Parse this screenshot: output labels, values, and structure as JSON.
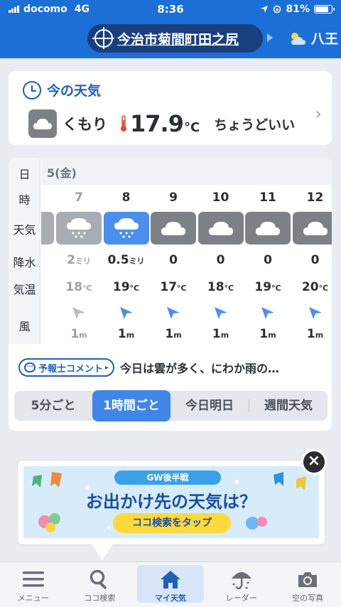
{
  "status_bar": {
    "carrier": "docomo",
    "network": "4G",
    "time": "8:36",
    "battery": "81%",
    "battery_level": 0.81
  },
  "header": {
    "location": "今治市菊間町田之尻",
    "next_location": "八王"
  },
  "current": {
    "title": "今の天気",
    "condition": "くもり",
    "temperature": "17.9",
    "unit": "°C",
    "feeling": "ちょうどいい"
  },
  "hourly": {
    "row_labels": {
      "day": "日",
      "hour": "時",
      "weather": "天気",
      "precip": "降水",
      "temp": "気温",
      "wind": "風"
    },
    "day": "5(金)",
    "hours": [
      {
        "hour": "7",
        "icon": "rain-icon",
        "precip": "2",
        "precip_unit": "ミリ",
        "temp": "18",
        "temp_unit": "°C",
        "wind": "1",
        "wind_unit": "m",
        "state": "past"
      },
      {
        "hour": "8",
        "icon": "rain-icon",
        "precip": "0.5",
        "precip_unit": "ミリ",
        "temp": "19",
        "temp_unit": "°C",
        "wind": "1",
        "wind_unit": "m",
        "state": "active"
      },
      {
        "hour": "9",
        "icon": "cloud-icon",
        "precip": "0",
        "precip_unit": "",
        "temp": "17",
        "temp_unit": "°C",
        "wind": "1",
        "wind_unit": "m",
        "state": ""
      },
      {
        "hour": "10",
        "icon": "cloud-icon",
        "precip": "0",
        "precip_unit": "",
        "temp": "18",
        "temp_unit": "°C",
        "wind": "1",
        "wind_unit": "m",
        "state": ""
      },
      {
        "hour": "11",
        "icon": "cloud-icon",
        "precip": "0",
        "precip_unit": "",
        "temp": "19",
        "temp_unit": "°C",
        "wind": "1",
        "wind_unit": "m",
        "state": ""
      },
      {
        "hour": "12",
        "icon": "cloud-icon",
        "precip": "0",
        "precip_unit": "",
        "temp": "20",
        "temp_unit": "°C",
        "wind": "1",
        "wind_unit": "m",
        "state": ""
      }
    ],
    "forecaster_tag": "予報士コメント",
    "forecaster_text": "今日は雲が多く、にわか雨の…",
    "segments": [
      "5分ごと",
      "1時間ごと",
      "今日明日",
      "週間天気"
    ],
    "active_segment": 1
  },
  "ad": {
    "badge": "GW後半戦",
    "headline": "お出かけ先の天気は？",
    "button": "ココ検索をタップ",
    "close": "×"
  },
  "tabbar": {
    "items": [
      {
        "label": "メニュー",
        "icon": "menu-icon"
      },
      {
        "label": "ココ検索",
        "icon": "search-icon"
      },
      {
        "label": "マイ天気",
        "icon": "home-icon"
      },
      {
        "label": "レーダー",
        "icon": "radar-umbrella-icon"
      },
      {
        "label": "空の写真",
        "icon": "camera-icon"
      }
    ],
    "active": 2
  },
  "colors": {
    "header_blue": "#1c6fd7",
    "accent_blue": "#3f86e8",
    "icon_gray": "#7d8186",
    "wind_arrow": "#4a8eee"
  }
}
